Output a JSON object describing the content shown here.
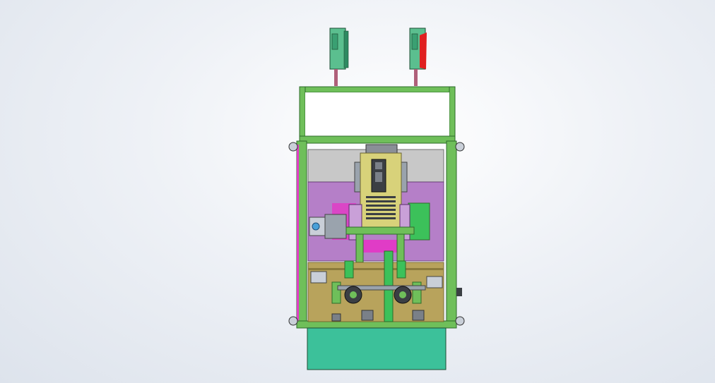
{
  "scene": {
    "description_free": true,
    "colors": {
      "frame_green": "#6fbf5a",
      "frame_dark": "#2e6b2a",
      "panel_purple": "#b57fc8",
      "panel_magenta": "#e03cc6",
      "base_gold": "#b8a35c",
      "base_teal": "#3cc19a",
      "housing_yellow": "#d8d27a",
      "gray_plate": "#c8c8c8",
      "cabinet_green": "#5bbf8f",
      "indicator_red": "#e02020",
      "bolt_gray": "#9aa3ad"
    }
  }
}
